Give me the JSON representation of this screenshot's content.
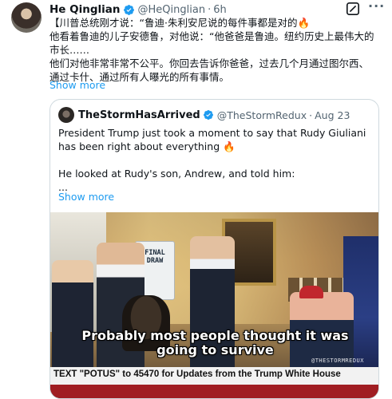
{
  "tweet": {
    "author_name": "He Qinglian",
    "author_handle": "@HeQinglian",
    "separator": "·",
    "time": "6h",
    "lines": [
      "【川普总统刚才说：“鲁迪·朱利安尼说的每件事都是对的🔥",
      "他看着鲁迪的儿子安德鲁，对他说：“他爸爸是鲁迪。纽约历史上最伟大的市长……",
      "他们对他非常非常不公平。你回去告诉你爸爸，过去几个月通过图尔西、通过卡什、通过所有人曝光的所有事情。"
    ],
    "show_more": "Show more"
  },
  "quote": {
    "author_name": "TheStormHasArrived",
    "author_handle": "@TheStormRedux",
    "separator": "·",
    "time": "Aug 23",
    "line1": "President Trump just took a moment to say that Rudy Giuliani has been right about everything 🔥",
    "line2": "He looked at Rudy's son, Andrew, and told him:",
    "line3": "...",
    "show_more": "Show more"
  },
  "media": {
    "sign_text": "FINAL DRAW",
    "caption": "Probably most people thought it was going to survive",
    "watermark": "@THESTORMREDUX",
    "banner": "TEXT \"POTUS\" to 45470 for Updates from the Trump White House"
  },
  "icons": {
    "verified": "verified-badge-icon",
    "grok": "grok-icon",
    "more": "more-options-icon"
  },
  "colors": {
    "accent": "#1d9bf0",
    "text": "#0f1419",
    "muted": "#536471",
    "border": "#cfd9de"
  }
}
